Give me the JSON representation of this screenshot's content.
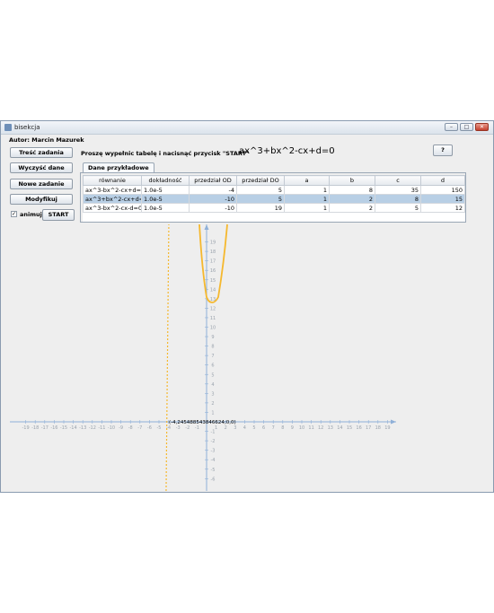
{
  "window": {
    "title": "bisekcja"
  },
  "author": "Autor: Marcin Mazurek",
  "sidebar": {
    "buttons": [
      "Treść zadania",
      "Wyczyść dane",
      "Nowe zadanie",
      "Modyfikuj"
    ],
    "animate_label": "animuj",
    "animate_checked": "✓",
    "start_label": "START"
  },
  "instruction": "Proszę wypełnic tabelę i nacisnąć przycisk \"START\"",
  "formula": "ax^3+bx^2-cx+d=0",
  "help_label": "?",
  "tab_label": "Dane przykładowe",
  "table": {
    "headers": [
      "równanie",
      "dokładność",
      "przedział OD",
      "przedział DO",
      "a",
      "b",
      "c",
      "d"
    ],
    "rows": [
      [
        "ax^3-bx^2-cx+d=0",
        "1.0e-5",
        "-4",
        "5",
        "1",
        "8",
        "35",
        "150"
      ],
      [
        "ax^3+bx^2-cx+d=0",
        "1.0e-5",
        "-10",
        "5",
        "1",
        "2",
        "8",
        "15"
      ],
      [
        "ax^3-bx^2-cx-d=0",
        "1.0e-5",
        "-10",
        "19",
        "1",
        "2",
        "5",
        "12"
      ]
    ],
    "selected_row": 1
  },
  "plot": {
    "x_ticks": [
      "-19",
      "-18",
      "-17",
      "-16",
      "-15",
      "-14",
      "-13",
      "-12",
      "-11",
      "-10",
      "-9",
      "-8",
      "-7",
      "-6",
      "-5",
      "-4",
      "-3",
      "-2",
      "-1",
      "0",
      "1",
      "2",
      "3",
      "4",
      "5",
      "6",
      "7",
      "8",
      "9",
      "10",
      "11",
      "12",
      "13",
      "14",
      "15",
      "16",
      "17",
      "18",
      "19"
    ],
    "y_ticks": [
      "19",
      "18",
      "17",
      "16",
      "15",
      "14",
      "13",
      "12",
      "11",
      "10",
      "9",
      "8",
      "7",
      "6",
      "5",
      "4",
      "3",
      "2",
      "1",
      "-1",
      "-2",
      "-3",
      "-4",
      "-5",
      "-6"
    ],
    "root_label": "(-4,245488543846624;0,0)",
    "curve_color": "#f5b82e",
    "axis_color": "#8fb0d8",
    "label_color": "#9aa3ad"
  }
}
